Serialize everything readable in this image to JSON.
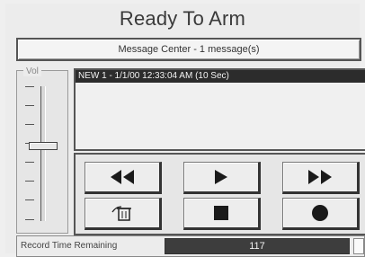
{
  "window": {
    "title": "Ready To Arm"
  },
  "message_center": {
    "label": "Message Center - 1 message(s)"
  },
  "volume": {
    "label": "Vol"
  },
  "messages": [
    {
      "text": "NEW  1  - 1/1/00 12:33:04 AM (10 Sec)"
    }
  ],
  "controls": {
    "rewind_icon": "rewind-icon",
    "play_icon": "play-icon",
    "fast_forward_icon": "fast-forward-icon",
    "delete_icon": "trash-can-icon",
    "stop_icon": "stop-icon",
    "record_icon": "record-icon"
  },
  "status": {
    "record_time_label": "Record Time Remaining",
    "record_time_value": "117"
  }
}
